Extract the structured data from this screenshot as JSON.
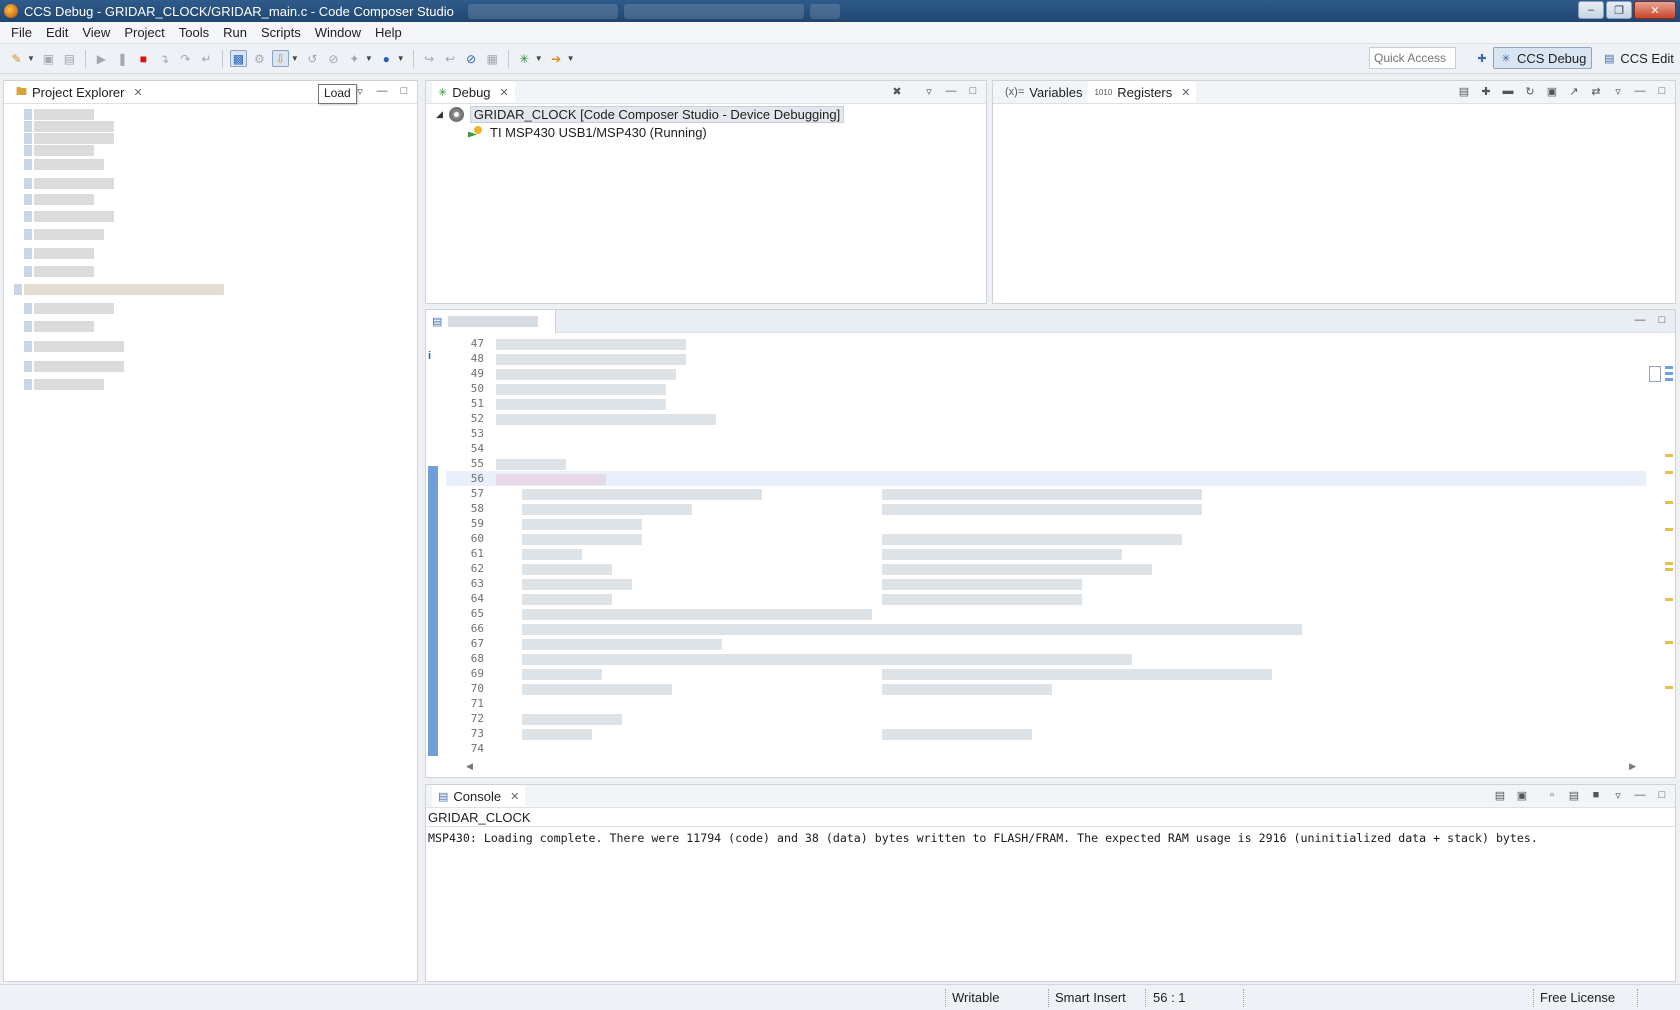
{
  "window": {
    "title": "CCS Debug - GRIDAR_CLOCK/GRIDAR_main.c - Code Composer Studio"
  },
  "menu": [
    "File",
    "Edit",
    "View",
    "Project",
    "Tools",
    "Run",
    "Scripts",
    "Window",
    "Help"
  ],
  "toolbar": {
    "quick_access_placeholder": "Quick Access",
    "perspectives": [
      {
        "label": "CCS Debug",
        "active": true,
        "icon": "bug-icon"
      },
      {
        "label": "CCS Edit",
        "active": false,
        "icon": "edit-perspective-icon"
      }
    ]
  },
  "project_explorer": {
    "tab_label": "Project Explorer",
    "tooltip": "Load"
  },
  "debug_view": {
    "tab_label": "Debug",
    "session": "GRIDAR_CLOCK [Code Composer Studio - Device Debugging]",
    "thread": "TI MSP430 USB1/MSP430 (Running)"
  },
  "variables_view": {
    "tabs": [
      {
        "label": "Variables",
        "icon": "variables-icon",
        "prefix": "(x)="
      },
      {
        "label": "Registers",
        "icon": "registers-icon",
        "prefix": "1010"
      }
    ]
  },
  "editor": {
    "line_numbers": [
      "47",
      "48",
      "49",
      "50",
      "51",
      "52",
      "53",
      "54",
      "55",
      "56",
      "57",
      "58",
      "59",
      "60",
      "61",
      "62",
      "63",
      "64",
      "65",
      "66",
      "67",
      "68",
      "69",
      "70",
      "71",
      "72",
      "73",
      "74"
    ],
    "current_line": "56"
  },
  "console": {
    "tab_label": "Console",
    "session_label": "GRIDAR_CLOCK",
    "output": "MSP430: Loading complete. There were 11794 (code) and 38 (data) bytes written to FLASH/FRAM. The expected RAM usage is 2916 (uninitialized data + stack) bytes."
  },
  "status_bar": {
    "writable": "Writable",
    "insert_mode": "Smart Insert",
    "cursor_position": "56 : 1",
    "license": "Free License"
  },
  "colors": {
    "title_bar": "#2f5b8c",
    "selection": "#d9e5f3",
    "current_line": "#e9f0fb"
  }
}
